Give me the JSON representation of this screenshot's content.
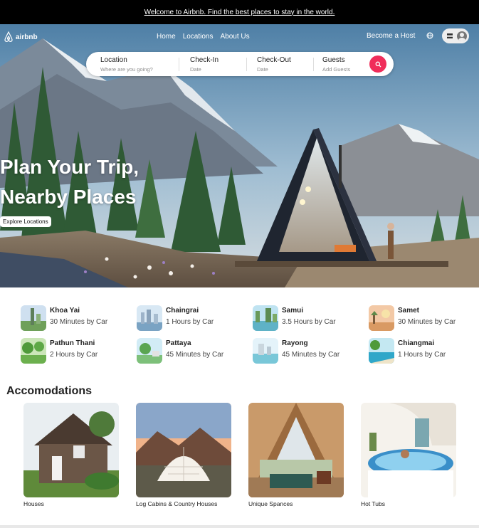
{
  "announcement": "Welcome to Airbnb. Find the best places to stay in the world.",
  "brand": {
    "name": "airbnb",
    "accent": "#f02d5a"
  },
  "nav": {
    "links": [
      "Home",
      "Locations",
      "About Us"
    ],
    "become_host": "Become a Host",
    "icons": [
      "airbnb-logo-icon",
      "globe-icon",
      "menu-icon",
      "user-avatar-icon"
    ]
  },
  "search": {
    "location": {
      "label": "Location",
      "placeholder": "Where are you going?"
    },
    "checkin": {
      "label": "Check-In",
      "placeholder": "Date"
    },
    "checkout": {
      "label": "Check-Out",
      "placeholder": "Date"
    },
    "guests": {
      "label": "Guests",
      "placeholder": "Add Guests"
    },
    "button_icon": "search-icon"
  },
  "hero": {
    "title_line1": "Plan Your Trip,",
    "title_line2": "Nearby Places",
    "cta": "Explore Locations"
  },
  "nearby": [
    {
      "name": "Khoa Yai",
      "duration": "30 Minutes by Car"
    },
    {
      "name": "Chaingrai",
      "duration": "1 Hours by Car"
    },
    {
      "name": "Samui",
      "duration": "3.5 Hours by Car"
    },
    {
      "name": "Samet",
      "duration": "30 Minutes by Car"
    },
    {
      "name": "Pathun Thani",
      "duration": "2 Hours by Car"
    },
    {
      "name": "Pattaya",
      "duration": "45 Minutes by Car"
    },
    {
      "name": "Rayong",
      "duration": "45 Minutes by Car"
    },
    {
      "name": "Chiangmai",
      "duration": "1 Hours by Car"
    }
  ],
  "accommodations": {
    "title": "Accomodations",
    "items": [
      {
        "label": "Houses"
      },
      {
        "label": "Log Cabins & Country Houses"
      },
      {
        "label": "Unique Spances"
      },
      {
        "label": "Hot Tubs"
      }
    ]
  }
}
